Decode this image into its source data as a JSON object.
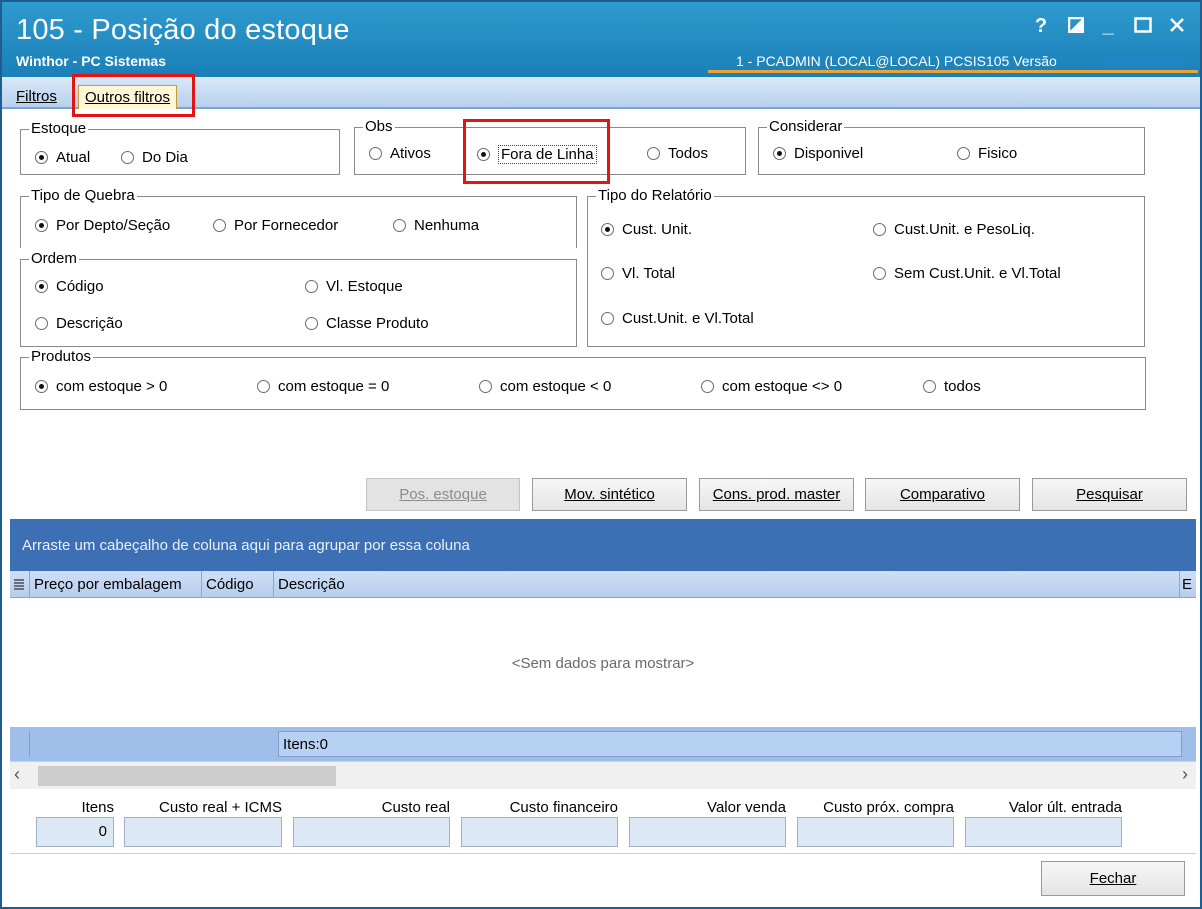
{
  "window": {
    "title": "105 - Posição do estoque",
    "subtitle": "Winthor - PC Sistemas",
    "session": "1 - PCADMIN (LOCAL@LOCAL)   PCSIS105   Versão",
    "controls": {
      "help": "?",
      "minimize": "_"
    }
  },
  "tabs": [
    {
      "label": "Filtros",
      "active": false
    },
    {
      "label": "Outros filtros",
      "active": true
    }
  ],
  "estoque": {
    "legend": "Estoque",
    "options": [
      {
        "label": "Atual",
        "selected": true
      },
      {
        "label": "Do Dia",
        "selected": false
      }
    ]
  },
  "obs": {
    "legend": "Obs",
    "options": [
      {
        "label": "Ativos",
        "selected": false
      },
      {
        "label": "Fora de Linha",
        "selected": true
      },
      {
        "label": "Todos",
        "selected": false
      }
    ]
  },
  "considerar": {
    "legend": "Considerar",
    "options": [
      {
        "label": "Disponivel",
        "selected": true
      },
      {
        "label": "Fisico",
        "selected": false
      }
    ]
  },
  "tipo_quebra": {
    "legend": "Tipo de Quebra",
    "options": [
      {
        "label": "Por Depto/Seção",
        "selected": true
      },
      {
        "label": "Por Fornecedor",
        "selected": false
      },
      {
        "label": "Nenhuma",
        "selected": false
      }
    ]
  },
  "ordem": {
    "legend": "Ordem",
    "options": [
      {
        "label": "Código",
        "selected": true
      },
      {
        "label": "Vl. Estoque",
        "selected": false
      },
      {
        "label": "Descrição",
        "selected": false
      },
      {
        "label": "Classe Produto",
        "selected": false
      }
    ]
  },
  "tipo_relatorio": {
    "legend": "Tipo do Relatório",
    "options": [
      {
        "label": "Cust. Unit.",
        "selected": true
      },
      {
        "label": "Cust.Unit. e PesoLiq.",
        "selected": false
      },
      {
        "label": "Vl. Total",
        "selected": false
      },
      {
        "label": "Sem Cust.Unit. e Vl.Total",
        "selected": false
      },
      {
        "label": "Cust.Unit. e Vl.Total",
        "selected": false
      }
    ]
  },
  "produtos": {
    "legend": "Produtos",
    "options": [
      {
        "label": "com estoque > 0",
        "selected": true
      },
      {
        "label": "com estoque = 0",
        "selected": false
      },
      {
        "label": "com estoque < 0",
        "selected": false
      },
      {
        "label": "com estoque <> 0",
        "selected": false
      },
      {
        "label": "todos",
        "selected": false
      }
    ]
  },
  "actions": {
    "pos_estoque": "Pos. estoque",
    "mov_sintetico": "Mov. sintético",
    "cons_prod_master": "Cons. prod. master",
    "comparativo": "Comparativo",
    "pesquisar": "Pesquisar"
  },
  "grid": {
    "group_hint": "Arraste um cabeçalho de coluna aqui para agrupar por essa coluna",
    "columns": [
      "Preço por embalagem",
      "Código",
      "Descrição",
      "E"
    ],
    "empty_text": "<Sem dados para mostrar>",
    "footer_count": "Itens:0"
  },
  "totals": [
    {
      "label": "Itens",
      "value": "0"
    },
    {
      "label": "Custo real + ICMS",
      "value": ""
    },
    {
      "label": "Custo real",
      "value": ""
    },
    {
      "label": "Custo financeiro",
      "value": ""
    },
    {
      "label": "Valor venda",
      "value": ""
    },
    {
      "label": "Custo próx. compra",
      "value": ""
    },
    {
      "label": "Valor últ. entrada",
      "value": ""
    }
  ],
  "close_label": "Fechar"
}
